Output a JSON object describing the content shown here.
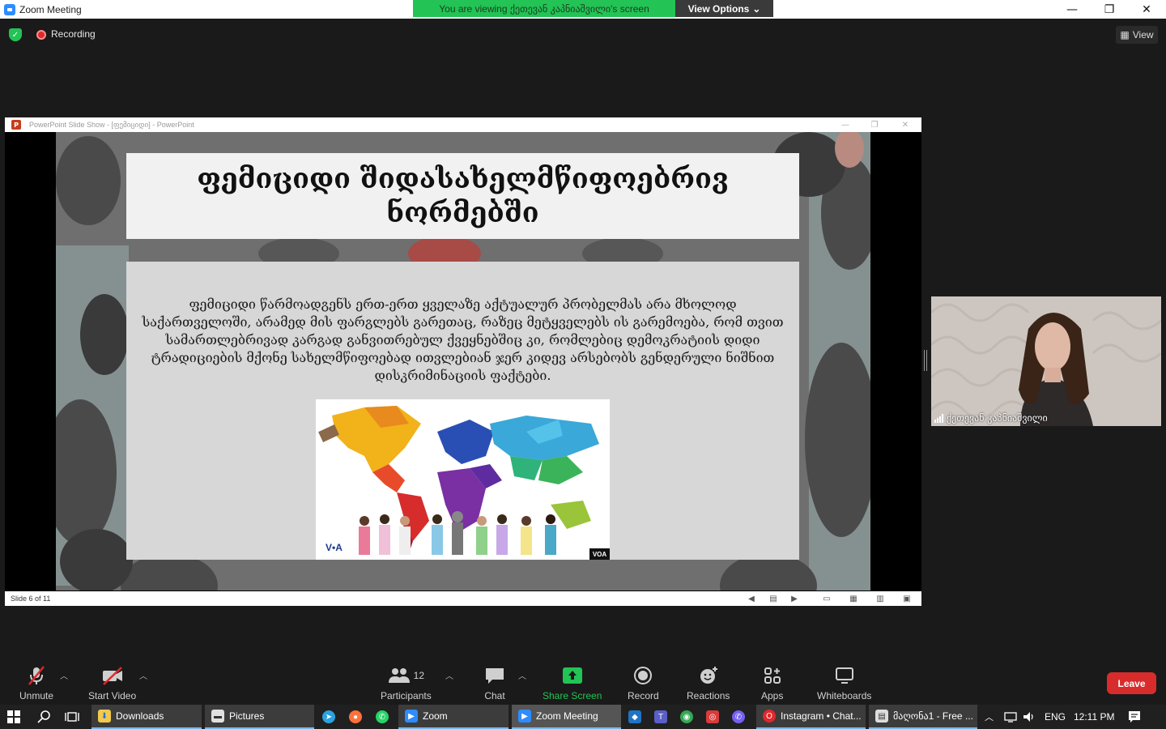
{
  "window": {
    "title": "Zoom Meeting",
    "viewing_banner": "You are viewing ქეთევან კაპნიაშვილი's screen",
    "view_options": "View Options",
    "minimize": "—",
    "restore": "❐",
    "close": "✕"
  },
  "overlay": {
    "recording": "Recording",
    "view": "View"
  },
  "powerpoint": {
    "title": "PowerPoint Slide Show - [ფემიციდი] - PowerPoint",
    "slide_number": "Slide 6 of 11"
  },
  "slide": {
    "title": "ფემიციდი შიდასახელმწიფოებრივ ნორმებში",
    "body": "ფემიციდი წარმოადგენს ერთ-ერთ ყველაზე აქტუალურ პრობელმას არა მხოლოდ საქართველოში, არამედ მის ფარგლებს გარეთაც, რაზეც მეტყველებს ის გარემოება, რომ თვით სამართლებრივად კარგად განვითრებულ ქვეყნებშიც კი, რომლებიც დემოკრატიის დიდი ტრადიციების მქონე სახელმწიფოებად ითვლებიან ჯერ კიდევ არსებობს გენდერული ნიშნით დისკრიმინაციის ფაქტები.",
    "image_logo": "V•A",
    "image_badge": "VOA"
  },
  "participant": {
    "name": "ქეთევან კაპნიაშვილი"
  },
  "toolbar": {
    "unmute": "Unmute",
    "start_video": "Start Video",
    "participants": "Participants",
    "participant_count": "12",
    "chat": "Chat",
    "share_screen": "Share Screen",
    "record": "Record",
    "reactions": "Reactions",
    "apps": "Apps",
    "whiteboards": "Whiteboards",
    "leave": "Leave"
  },
  "taskbar": {
    "downloads": "Downloads",
    "pictures": "Pictures",
    "zoom": "Zoom",
    "zoom_meeting": "Zoom Meeting",
    "instagram": "Instagram • Chat...",
    "document": "მაღონა1 - Free ...",
    "language": "ENG",
    "time": "12:11 PM"
  },
  "colors": {
    "share_green": "#23c355",
    "leave_red": "#d82c2c",
    "toolbar_bg": "#1a1a1a"
  }
}
